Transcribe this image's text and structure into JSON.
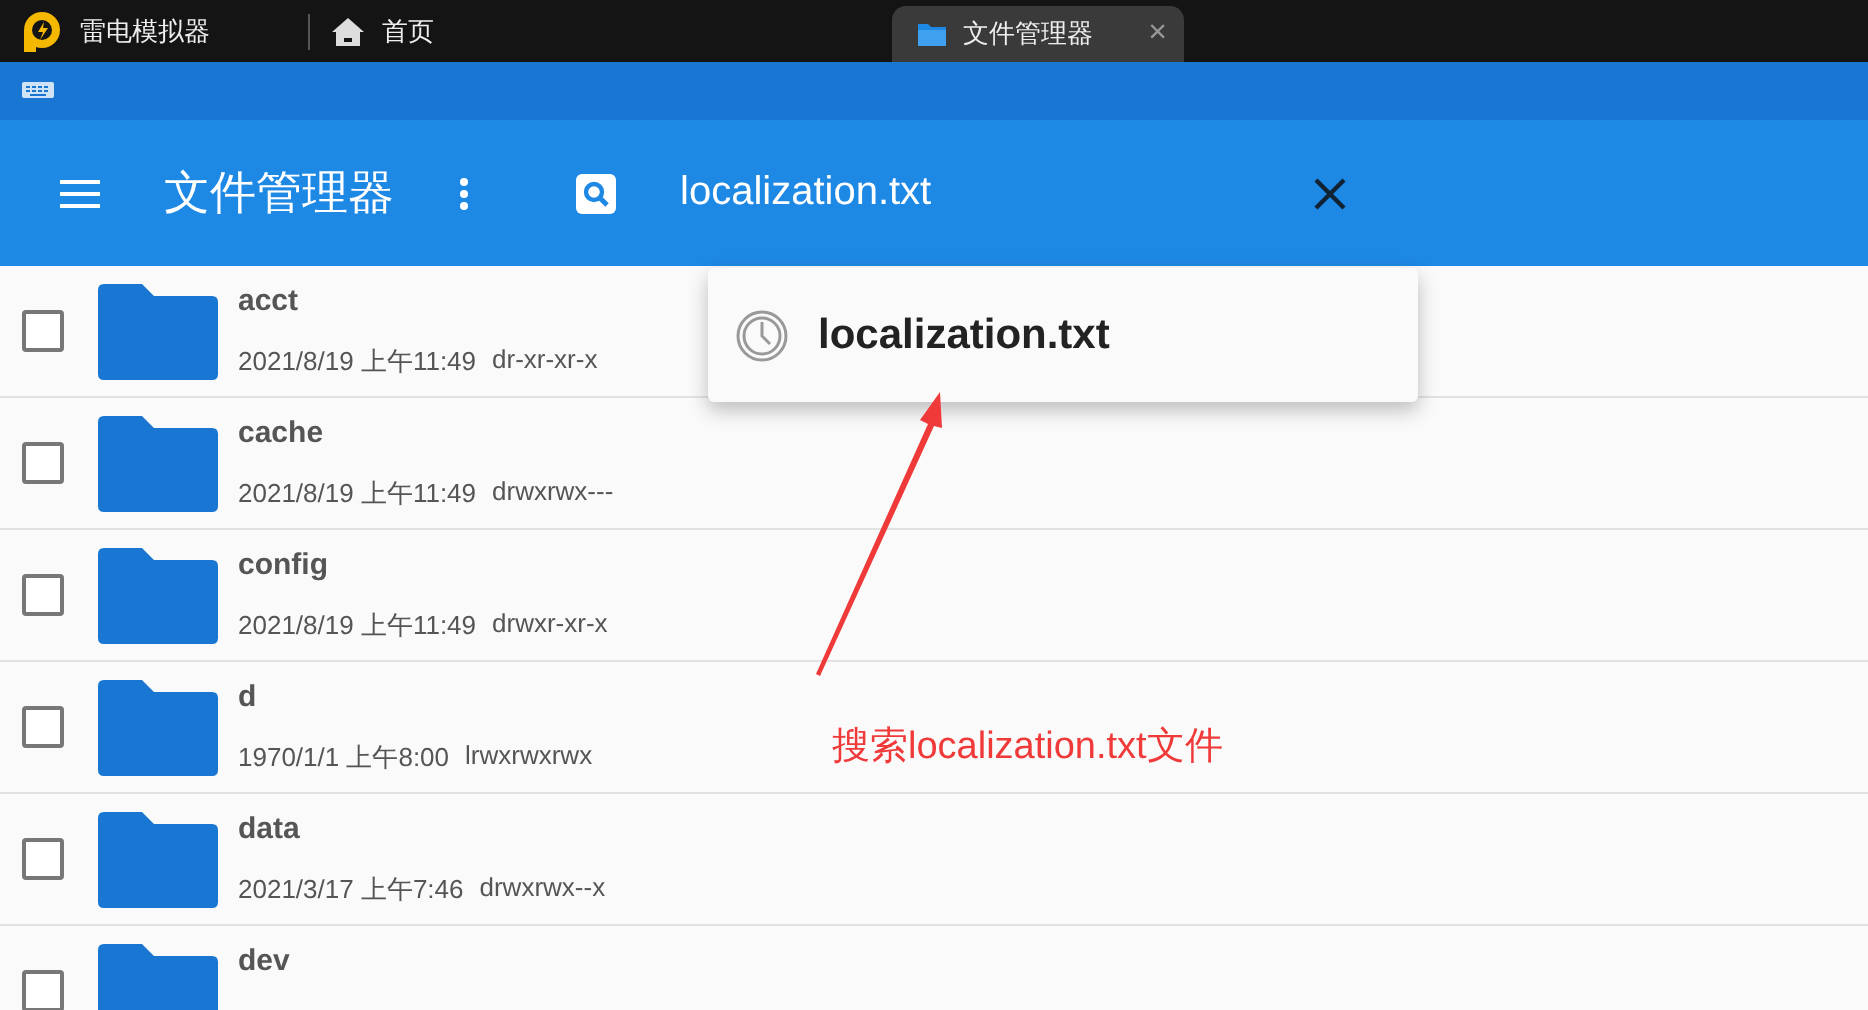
{
  "emulator_tabs": [
    {
      "label": "雷电模拟器",
      "kind": "brand",
      "selected": false
    },
    {
      "label": "首页",
      "kind": "home",
      "selected": false
    },
    {
      "label": "文件管理器",
      "kind": "folder",
      "selected": true,
      "close": "×"
    }
  ],
  "app_bar": {
    "title": "文件管理器",
    "search_value": "localization.txt"
  },
  "suggestions": [
    {
      "text": "localization.txt"
    }
  ],
  "files": [
    {
      "name": "acct",
      "date": "2021/8/19 上午11:49",
      "perms": "dr-xr-xr-x",
      "checked": false
    },
    {
      "name": "cache",
      "date": "2021/8/19 上午11:49",
      "perms": "drwxrwx---",
      "checked": false
    },
    {
      "name": "config",
      "date": "2021/8/19 上午11:49",
      "perms": "drwxr-xr-x",
      "checked": false
    },
    {
      "name": "d",
      "date": "1970/1/1 上午8:00",
      "perms": "lrwxrwxrwx",
      "checked": false
    },
    {
      "name": "data",
      "date": "2021/3/17 上午7:46",
      "perms": "drwxrwx--x",
      "checked": false
    },
    {
      "name": "dev",
      "checked": false
    }
  ],
  "annotation": {
    "text": "搜索localization.txt文件"
  }
}
